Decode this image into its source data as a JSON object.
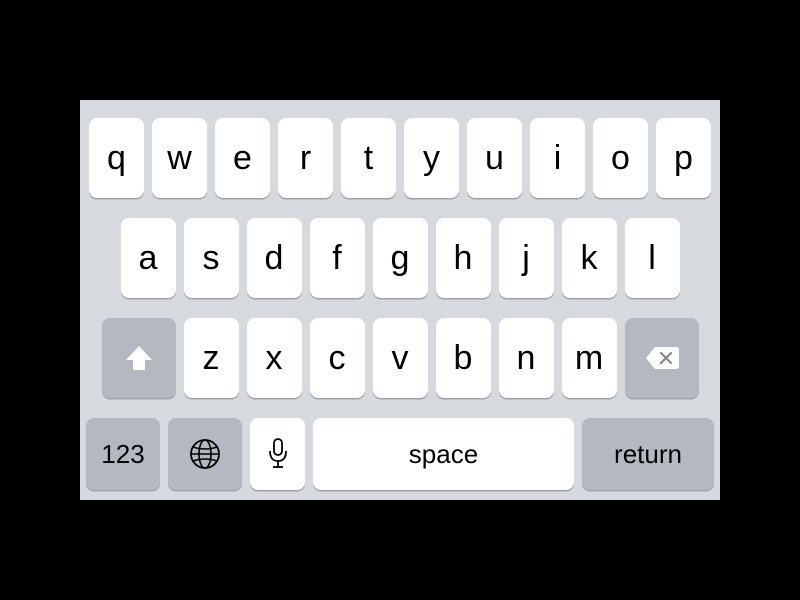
{
  "keyboard": {
    "row1": [
      "q",
      "w",
      "e",
      "r",
      "t",
      "y",
      "u",
      "i",
      "o",
      "p"
    ],
    "row2": [
      "a",
      "s",
      "d",
      "f",
      "g",
      "h",
      "j",
      "k",
      "l"
    ],
    "row3": [
      "z",
      "x",
      "c",
      "v",
      "b",
      "n",
      "m"
    ],
    "numbers_label": "123",
    "space_label": "space",
    "return_label": "return"
  }
}
